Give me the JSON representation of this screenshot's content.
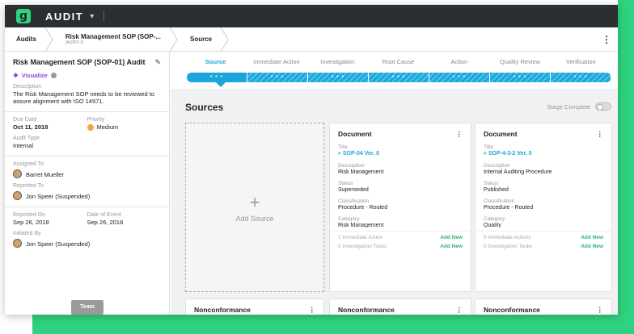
{
  "app": {
    "title": "AUDIT",
    "logo": "g-logo"
  },
  "breadcrumb": [
    {
      "label": "Audits",
      "sub": ""
    },
    {
      "label": "Risk Management SOP (SOP-...",
      "sub": "(AUDIT-1)"
    },
    {
      "label": "Source",
      "sub": ""
    }
  ],
  "sidebar": {
    "title": "Risk Management SOP (SOP-01) Audit",
    "visualize": "Visualize",
    "description_label": "Description",
    "description": "The Risk Management SOP needs to be reviewed to assure alignment with ISO 14971.",
    "due_date_label": "Due Date",
    "due_date": "Oct 11, 2018",
    "priority_label": "Priority",
    "priority": "Medium",
    "audit_type_label": "Audit Type",
    "audit_type": "Internal",
    "assigned_to_label": "Assigned To",
    "assigned_to": "Barret Mueller",
    "reported_to_label": "Reported To",
    "reported_to": "Jon Speer (Suspended)",
    "reported_on_label": "Reported On",
    "reported_on": "Sep 26, 2018",
    "date_of_event_label": "Date of Event",
    "date_of_event": "Sep 26, 2018",
    "initiated_by_label": "Initiated By",
    "initiated_by": "Jon Speer (Suspended)",
    "team_button": "Team"
  },
  "stages": {
    "labels": [
      "Source",
      "Immediate Action",
      "Investigation",
      "Root Cause",
      "Action",
      "Quality Review",
      "Verification"
    ],
    "active": "Source",
    "dots": "• • •"
  },
  "sources": {
    "heading": "Sources",
    "stage_complete": "Stage Complete",
    "add_source": "Add Source",
    "plus": "+"
  },
  "cards": [
    {
      "type": "Document",
      "title_label": "Title",
      "title": "SOP-04 Ver. 0",
      "description_label": "Description",
      "description": "Risk Management",
      "status_label": "Status",
      "status": "Superseded",
      "classification_label": "Classification",
      "classification": "Procedure - Routed",
      "category_label": "Category",
      "category": "Risk Management",
      "footer1": "1 Immediate Action",
      "footer2": "0 Investigation Tasks",
      "add_new": "Add New"
    },
    {
      "type": "Document",
      "title_label": "Title",
      "title": "SOP-4-3-2 Ver. 0",
      "description_label": "Description",
      "description": "Internal Auditing Procedure",
      "status_label": "Status",
      "status": "Published",
      "classification_label": "Classification",
      "classification": "Procedure - Routed",
      "category_label": "Category",
      "category": "Quality",
      "footer1": "0 Immediate Actions",
      "footer2": "0 Investigation Tasks",
      "add_new": "Add New"
    }
  ],
  "bottom_cards": [
    "Nonconformance",
    "Nonconformance",
    "Nonconformance"
  ]
}
